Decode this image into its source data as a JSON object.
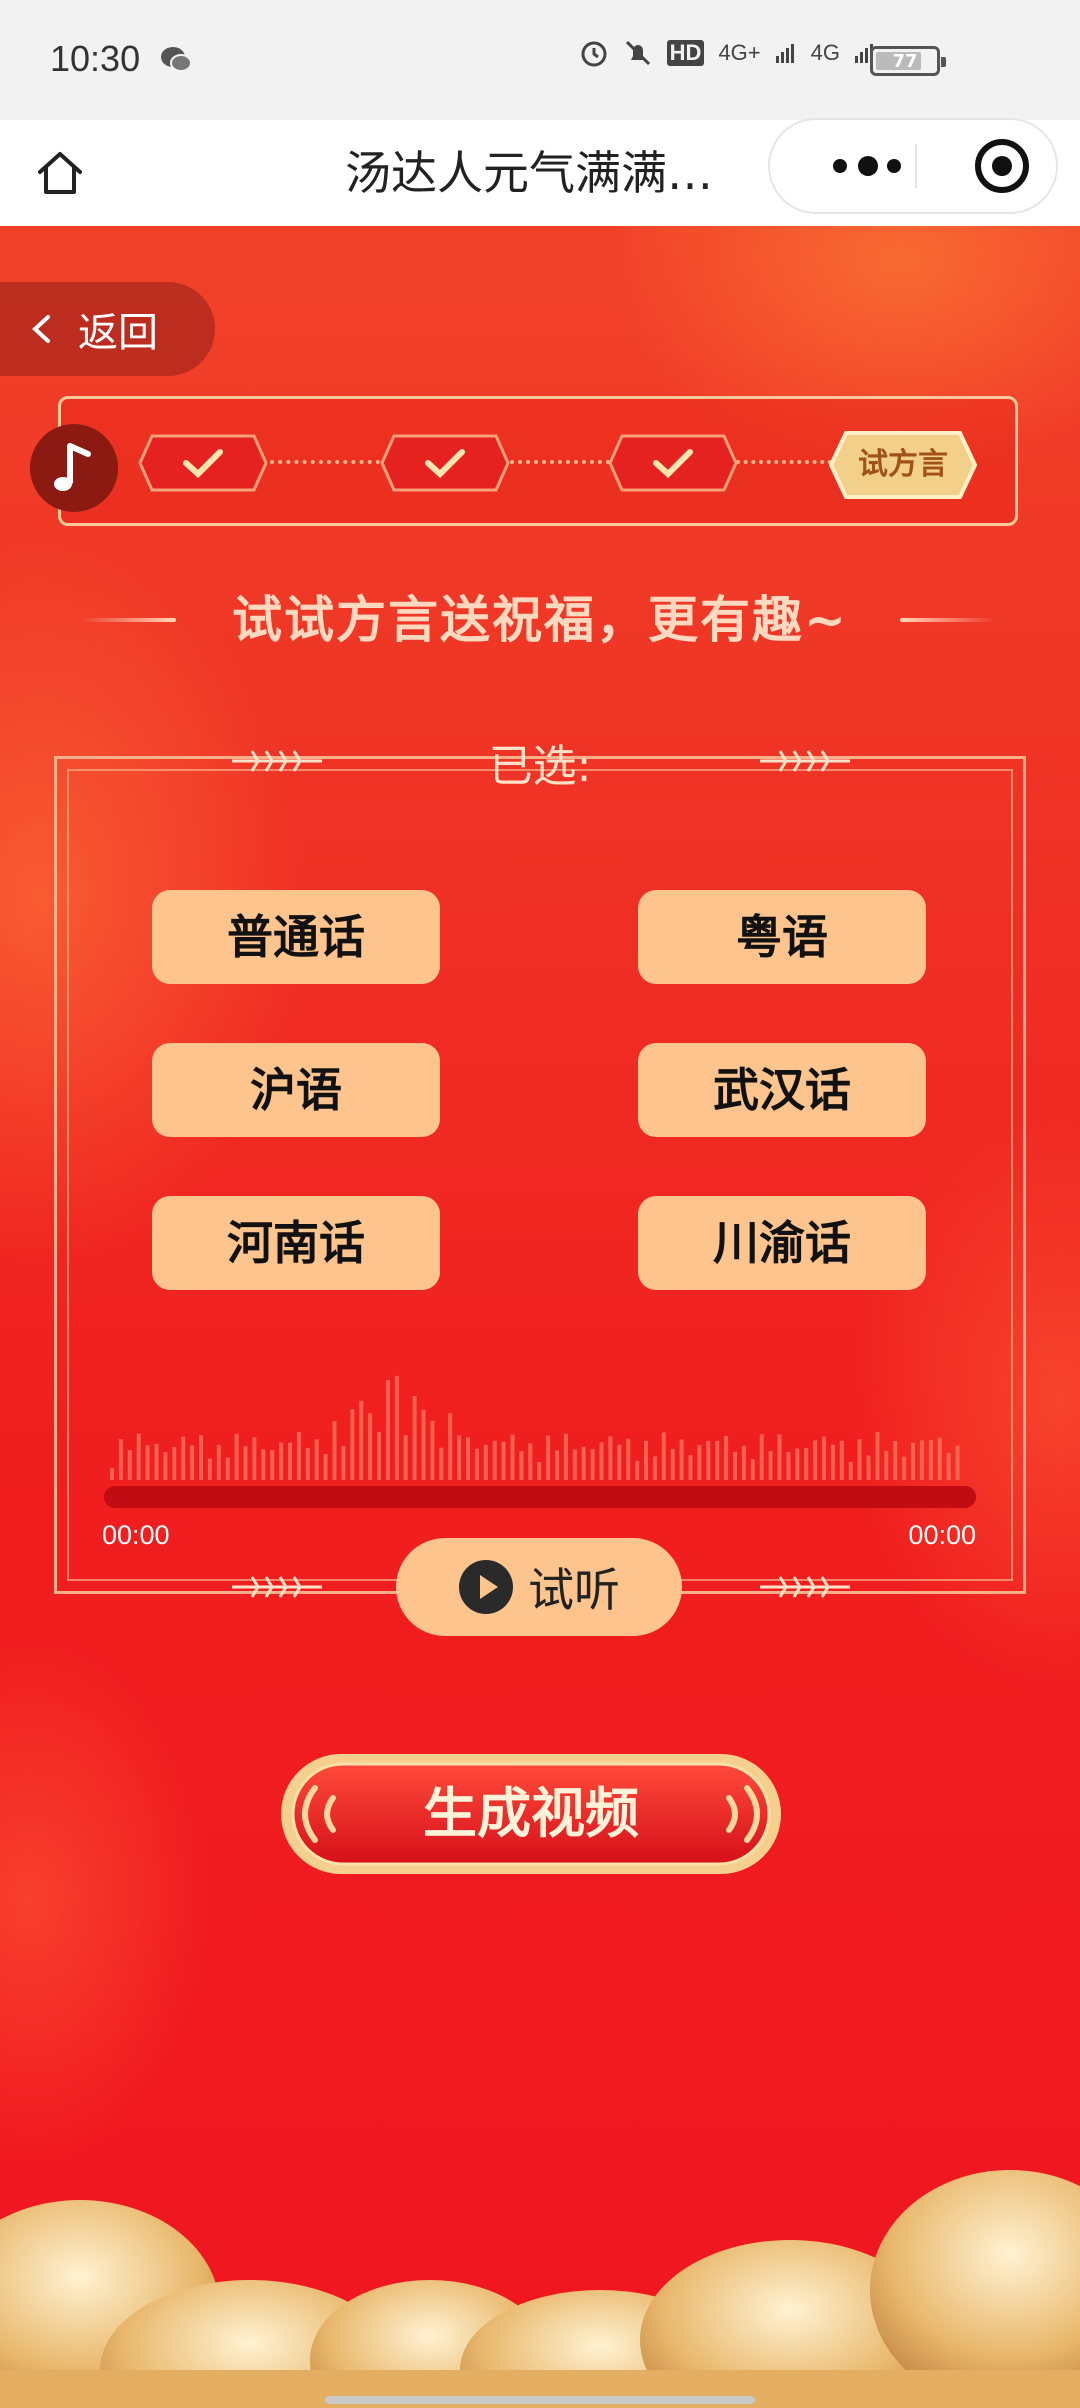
{
  "status_bar": {
    "time": "10:30",
    "battery": "77",
    "network_a": "4G+",
    "network_b": "4G",
    "hd": "HD"
  },
  "nav": {
    "title": "汤达人元气满满…"
  },
  "back": {
    "label": "返回"
  },
  "progress": {
    "current_step": "试方言",
    "completed_steps": 3
  },
  "headline": "试试方言送祝福，更有趣~",
  "selection": {
    "label": "已选:",
    "dialects": [
      "普通话",
      "粤语",
      "沪语",
      "武汉话",
      "河南话",
      "川渝话"
    ]
  },
  "player": {
    "current_time": "00:00",
    "total_time": "00:00",
    "listen_label": "试听"
  },
  "generate_label": "生成视频",
  "colors": {
    "accent_button": "#fec48e",
    "background": "#f01f1f",
    "gold": "#f3d08a"
  }
}
